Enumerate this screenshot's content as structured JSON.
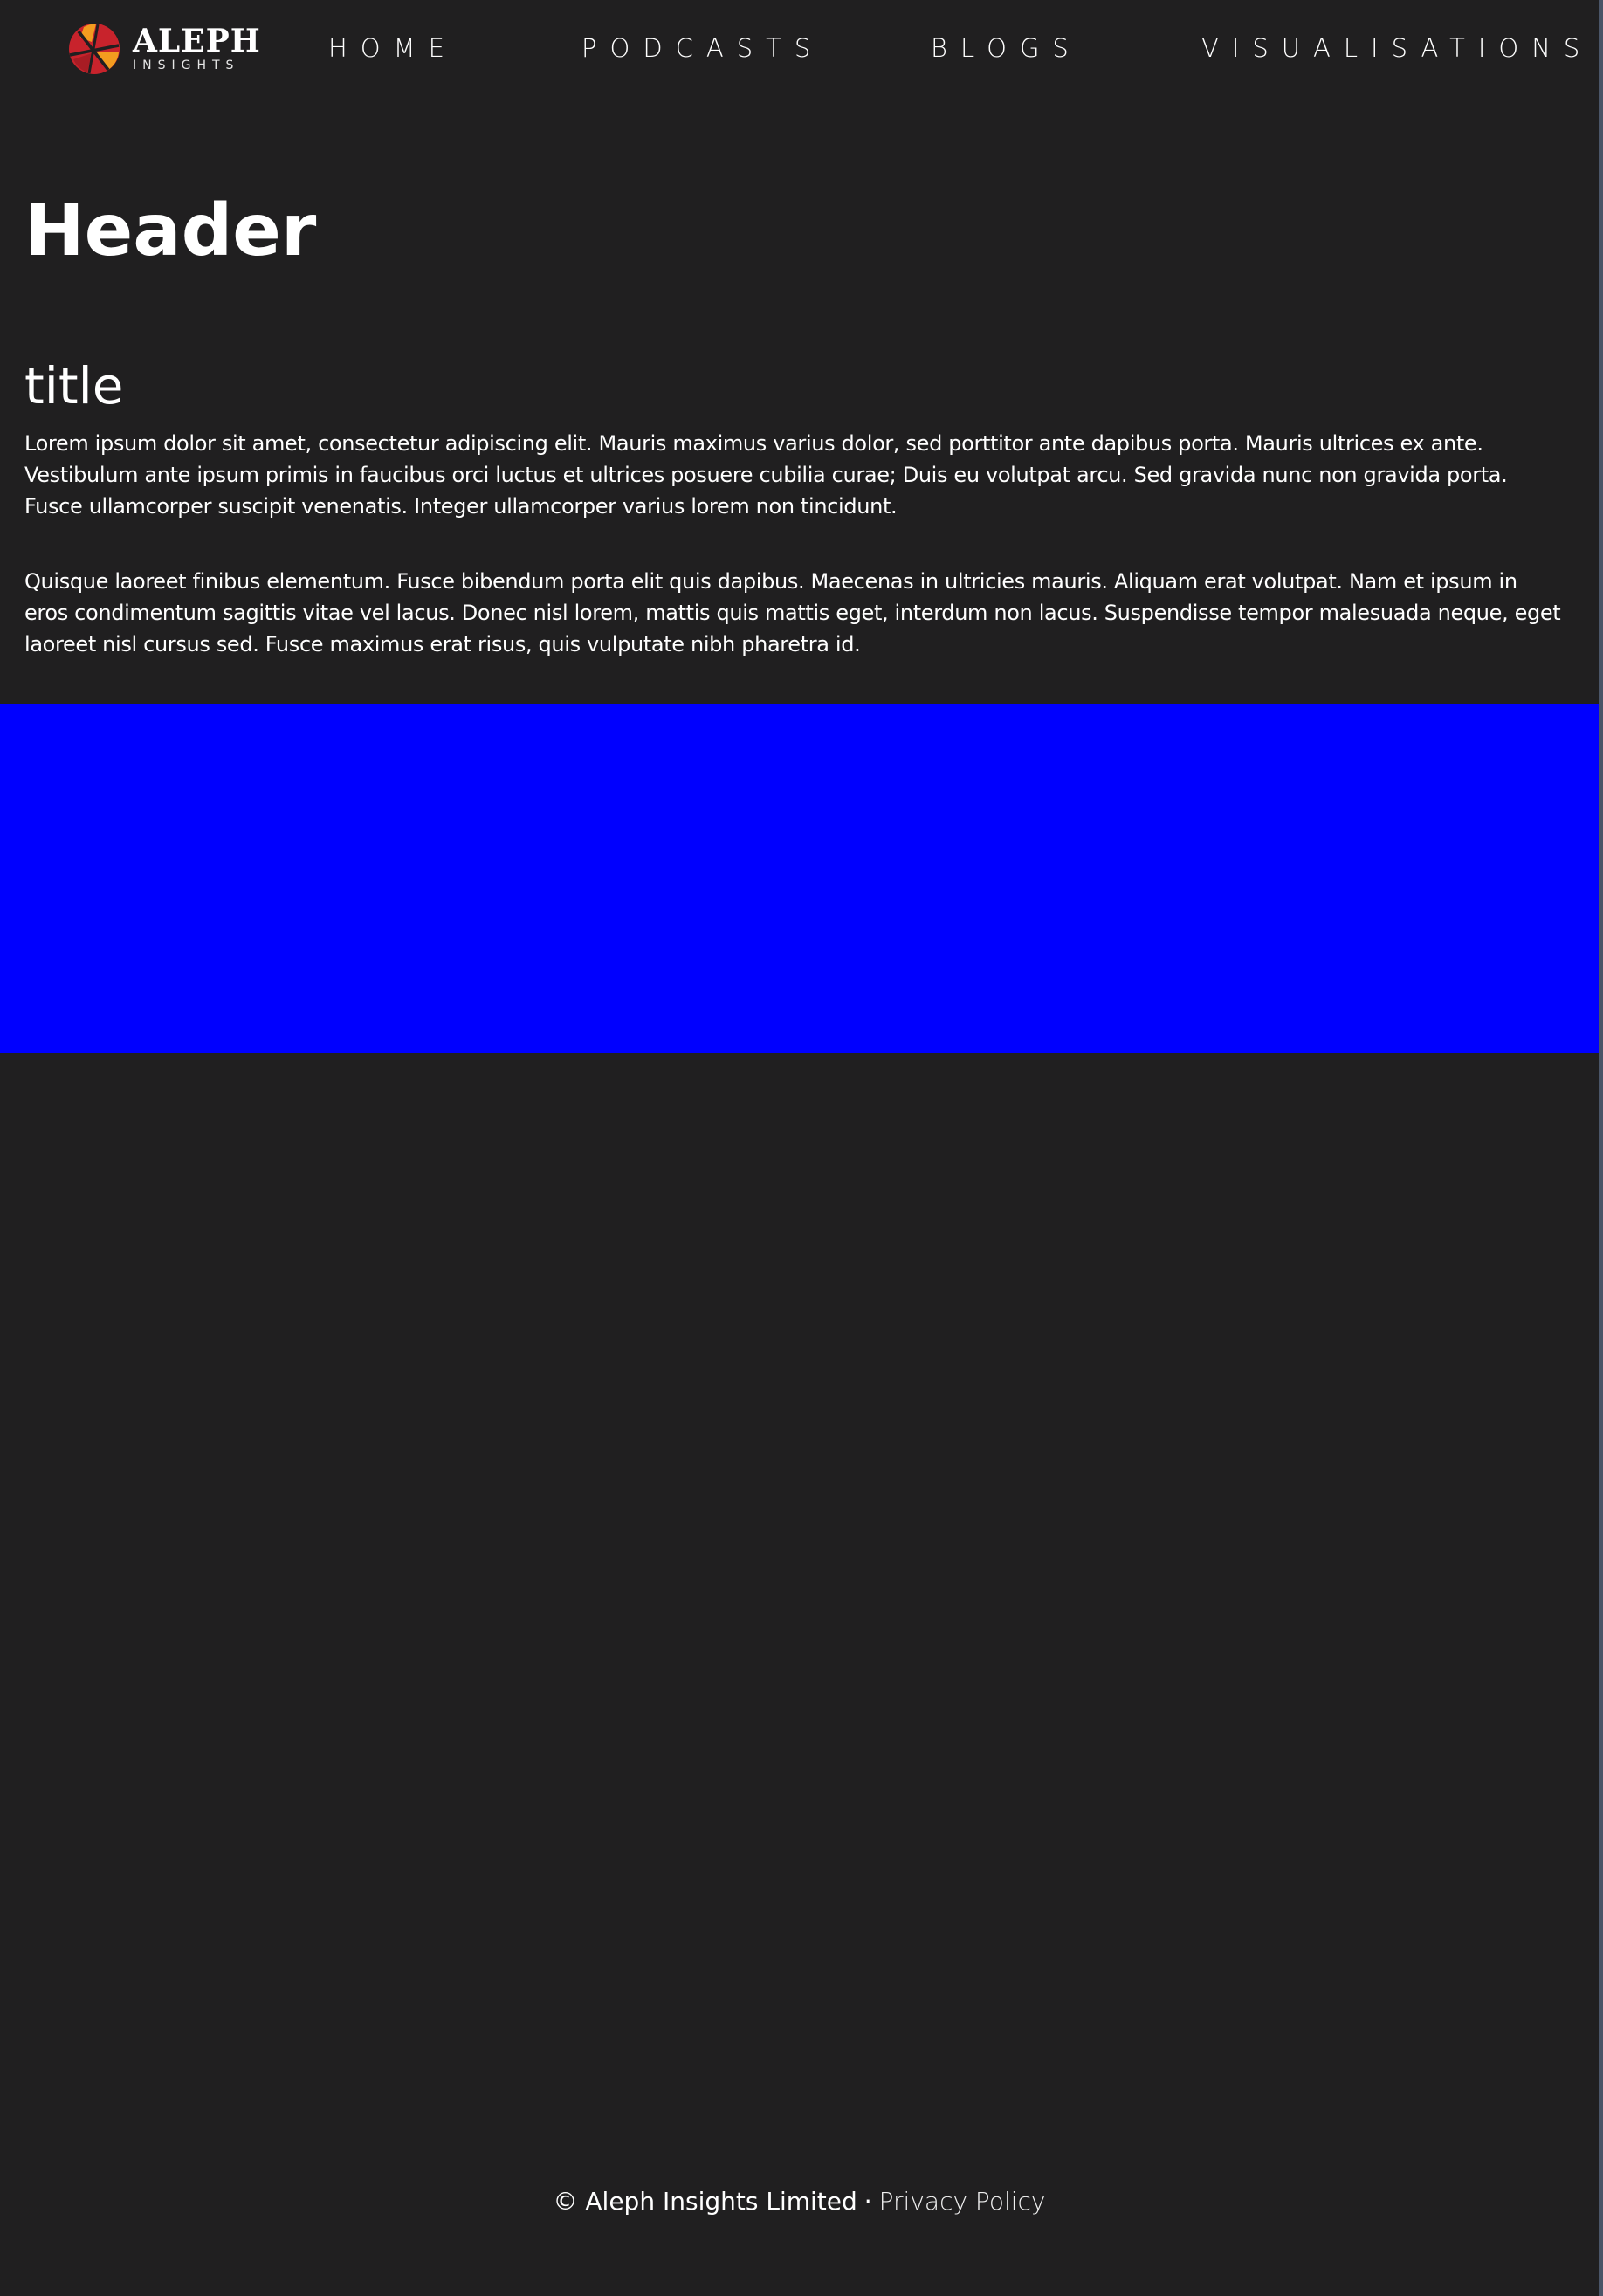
{
  "nav": {
    "logo": {
      "name": "ALEPH",
      "sub": "INSIGHTS",
      "icon": "aleph-logo-mark",
      "colors": {
        "red": "#c8232c",
        "orange": "#f39c1f"
      }
    },
    "links": [
      {
        "label": "HOME"
      },
      {
        "label": "PODCASTS"
      },
      {
        "label": "BLOGS"
      },
      {
        "label": "VISUALISATIONS"
      }
    ]
  },
  "main": {
    "header": "Header",
    "title": "title",
    "paragraphs": [
      "Lorem ipsum dolor sit amet, consectetur adipiscing elit. Mauris maximus varius dolor, sed porttitor ante dapibus porta. Mauris ultrices ex ante. Vestibulum ante ipsum primis in faucibus orci luctus et ultrices posuere cubilia curae; Duis eu volutpat arcu. Sed gravida nunc non gravida porta. Fusce ullamcorper suscipit venenatis. Integer ullamcorper varius lorem non tincidunt.",
      "Quisque laoreet finibus elementum. Fusce bibendum porta elit quis dapibus. Maecenas in ultricies mauris. Aliquam erat volutpat. Nam et ipsum in eros condimentum sagittis vitae vel lacus. Donec nisl lorem, mattis quis mattis eget, interdum non lacus. Suspendisse tempor malesuada neque, eget laoreet nisl cursus sed. Fusce maximus erat risus, quis vulputate nibh pharetra id."
    ],
    "band_color": "#0000ff"
  },
  "footer": {
    "copyright": "© Aleph Insights Limited",
    "separator": "·",
    "privacy_label": "Privacy Policy"
  },
  "colors": {
    "background": "#201f20",
    "text": "#ffffff",
    "accent_blue": "#0000ff"
  }
}
